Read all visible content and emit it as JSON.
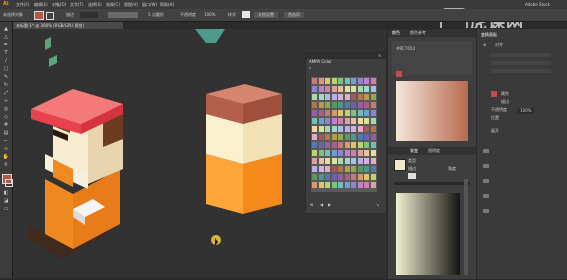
{
  "app": {
    "logo": "Ai",
    "brand_text": "虎课网",
    "watermark_icon": "tiger-paw-icon"
  },
  "menu": {
    "items": [
      "文件(F)",
      "编辑(E)",
      "对象(O)",
      "文字(T)",
      "选择(S)",
      "效果(C)",
      "视图(V)",
      "窗口(W)",
      "帮助(H)"
    ],
    "right_label": "Adobe Stock"
  },
  "control_bar": {
    "selection_label": "未选择对象",
    "stroke_label": "描边",
    "point_label": "5 点圆形",
    "opacity_label": "不透明度",
    "opacity_value": "100%",
    "style_label": "样式",
    "doc_setup_label": "文档设置",
    "prefs_label": "首选项"
  },
  "document": {
    "tab_title": "未标题-1* @ 300% (RGB/GPU 预览)"
  },
  "swatch_panel": {
    "title": "AMPA Color",
    "colors": [
      "#c97979",
      "#d99a6b",
      "#e0c46a",
      "#bcd46b",
      "#7cc383",
      "#6fc0b6",
      "#6f9fd6",
      "#8d85d4",
      "#c27fd0",
      "#d47fa6",
      "#e1a0a0",
      "#e8c29a",
      "#ecdb9d",
      "#d4e39d",
      "#a8d8ad",
      "#a3d6cf",
      "#a4c0e4",
      "#b8b1e3",
      "#d9ade2",
      "#e6aac4",
      "#a35959",
      "#b1764a",
      "#b89c48",
      "#93aa4a",
      "#58985f",
      "#4d9790",
      "#4d7bb0",
      "#6b62ad",
      "#9a5ca9",
      "#ad5c82"
    ]
  },
  "right_panels": {
    "color_tab": "颜色",
    "guide_tab": "颜色参考",
    "color_name": "#BC7654",
    "gradient_label": "渐变",
    "transparency_label": "透明度",
    "properties_label": "属性",
    "type_label": "类型",
    "stroke_label": "描边",
    "angle_label": "角度",
    "opacity_label": "不透明度",
    "location_label": "位置",
    "opacity_value": "100%",
    "expand_label": "展开",
    "gradient": {
      "start": "#f4e6d9",
      "end": "#b86a4f"
    },
    "gradient2": {
      "start": "#f2f0d2",
      "end": "#151512"
    },
    "accent_swatch": "#c94b45"
  },
  "far_right": {
    "title": "变换面板",
    "align_label": "对齐"
  }
}
